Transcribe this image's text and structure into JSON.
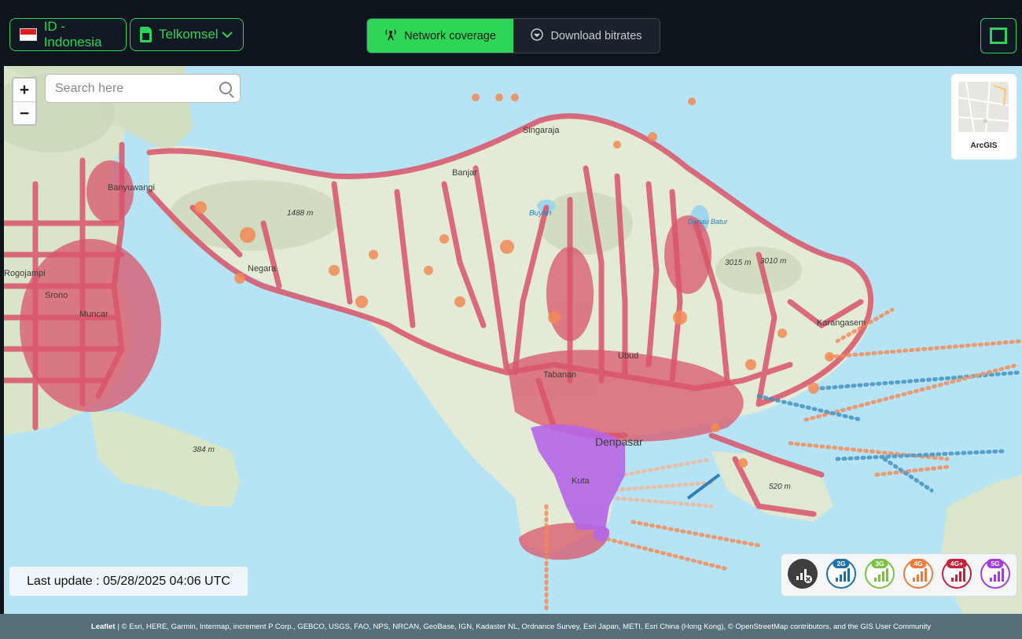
{
  "header": {
    "country": "ID - Indonesia",
    "operator": "Telkomsel",
    "tabs": [
      {
        "label": "Network coverage",
        "active": true,
        "icon": "antenna-icon"
      },
      {
        "label": "Download bitrates",
        "active": false,
        "icon": "download-circle-icon"
      }
    ],
    "fullscreen_icon": "fullscreen-icon"
  },
  "map": {
    "search_placeholder": "Search here",
    "zoom_in": "+",
    "zoom_out": "−",
    "basemap_label": "ArcGIS",
    "place_labels": [
      "Singaraja",
      "Banjar",
      "Banyuwangi",
      "1488 m",
      "Buyan",
      "Danau Batur",
      "3015 m",
      "3010 m",
      "Negara",
      "Rogojampi",
      "Srono",
      "Muncar",
      "Karangasem",
      "Ubud",
      "Tabanan",
      "Denpasar",
      "Kuta",
      "384 m",
      "520 m"
    ],
    "last_update": "Last update : 05/28/2025 04:06 UTC",
    "legend": [
      {
        "label": "no-signal",
        "color": "#444444"
      },
      {
        "label": "2G",
        "color": "#1f6fa8"
      },
      {
        "label": "3G",
        "color": "#7cc242"
      },
      {
        "label": "4G",
        "color": "#f07a3a"
      },
      {
        "label": "4G+",
        "color": "#c8203a"
      },
      {
        "label": "5G",
        "color": "#a23ce0"
      }
    ]
  },
  "footer": {
    "leaflet": "Leaflet",
    "attribution": "| © Esri, HERE, Garmin, Intermap, increment P Corp., GEBCO, USGS, FAO, NPS, NRCAN, GeoBase, IGN, Kadaster NL, Ordnance Survey, Esri Japan, METI, Esri China (Hong Kong), © OpenStreetMap contributors, and the GIS User Community"
  }
}
